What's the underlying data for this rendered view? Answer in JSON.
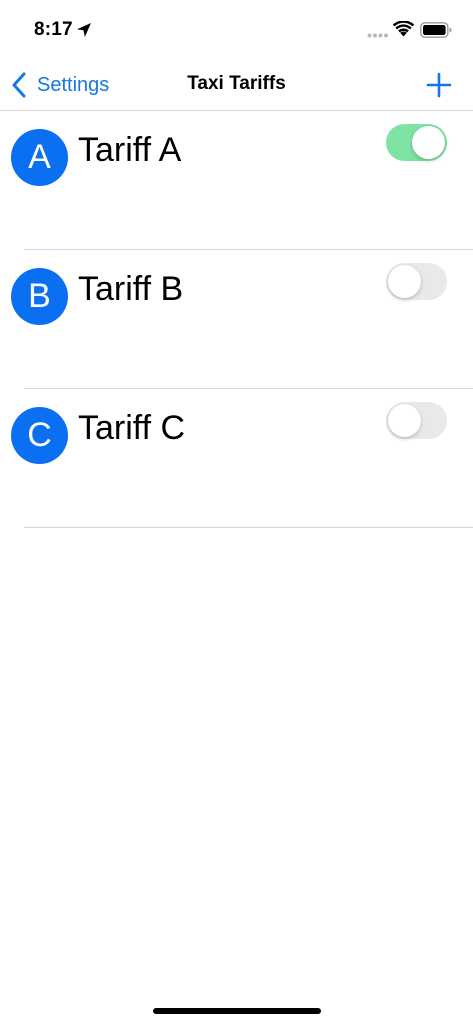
{
  "status_bar": {
    "time": "8:17",
    "icons": [
      "location-arrow-icon",
      "signal-dots-icon",
      "wifi-icon",
      "battery-icon"
    ]
  },
  "nav": {
    "back_label": "Settings",
    "title": "Taxi Tariffs",
    "add_icon": "plus-icon"
  },
  "colors": {
    "accent": "#1478e0",
    "avatar": "#0a6ff0",
    "toggle_on": "#7fe3a4",
    "toggle_off": "#e9e9eb"
  },
  "tariffs": [
    {
      "initial": "A",
      "name": "Tariff A",
      "enabled": true
    },
    {
      "initial": "B",
      "name": "Tariff B",
      "enabled": false
    },
    {
      "initial": "C",
      "name": "Tariff C",
      "enabled": false
    }
  ]
}
